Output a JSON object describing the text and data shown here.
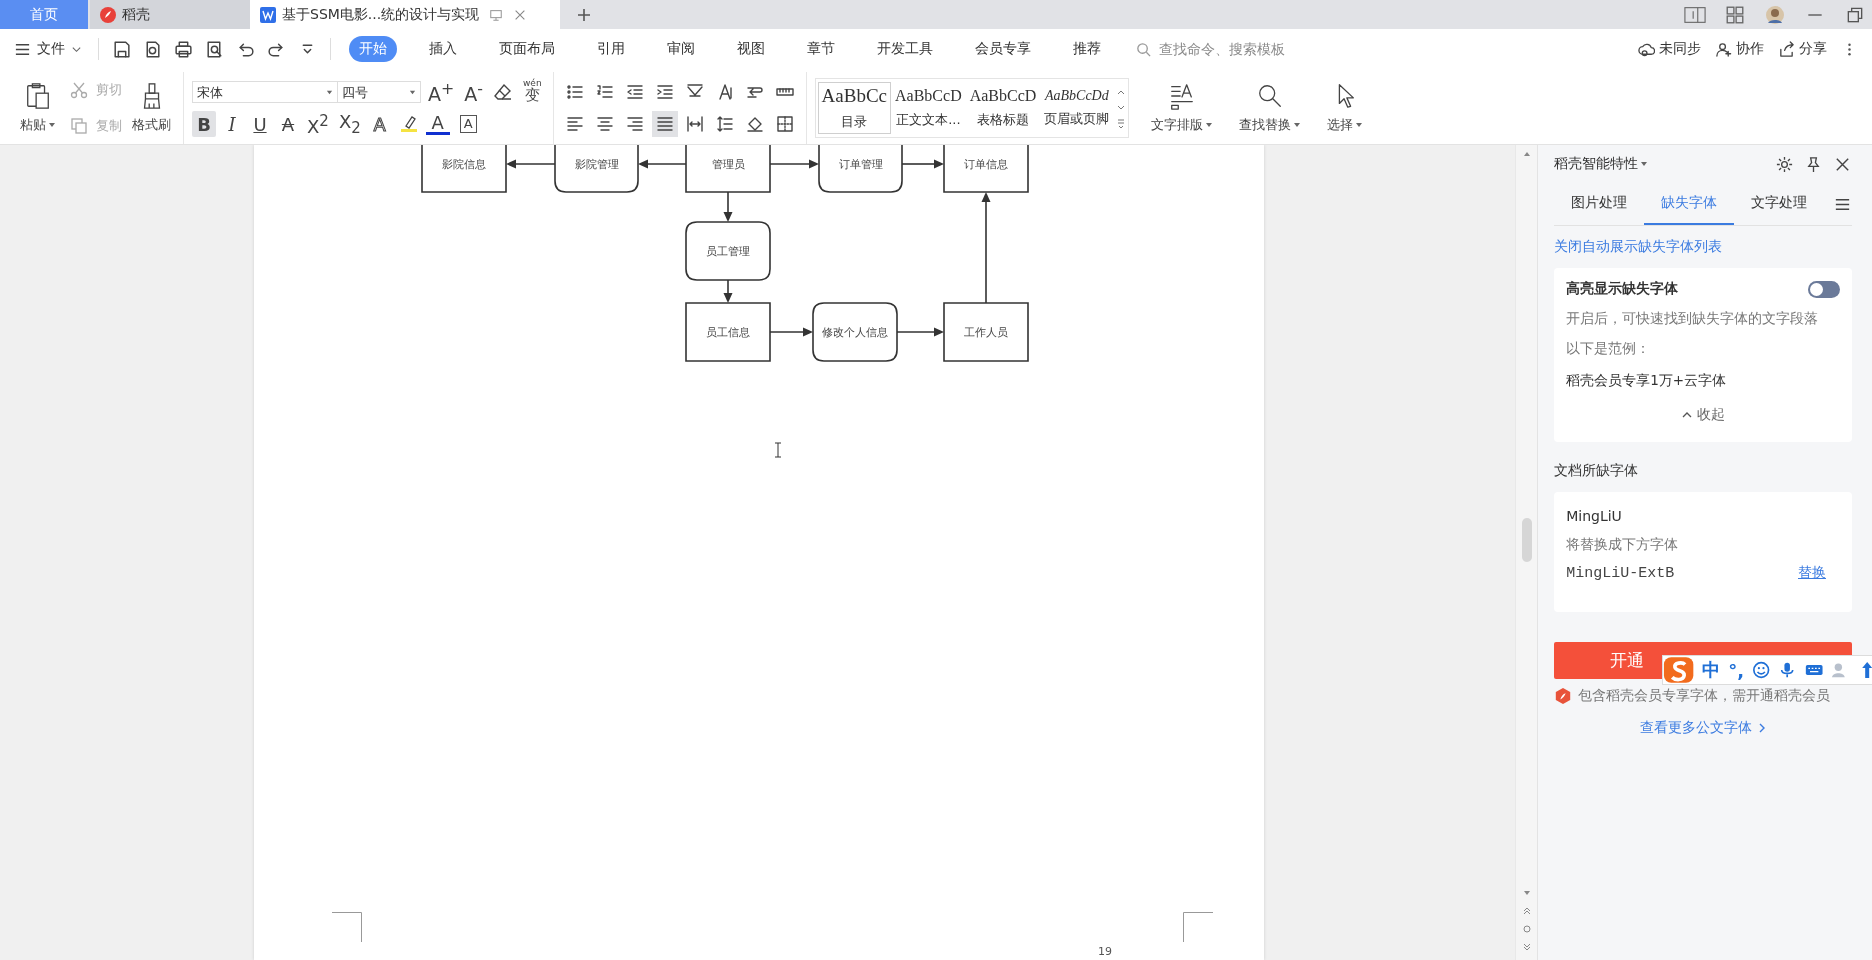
{
  "tabs": [
    {
      "label": "首页",
      "kind": "home",
      "selected": false
    },
    {
      "label": "稻壳",
      "kind": "app",
      "selected": false
    },
    {
      "label": "基于SSM电影...统的设计与实现",
      "kind": "document",
      "selected": true
    }
  ],
  "menu": {
    "file": "文件",
    "items": [
      {
        "label": "开始",
        "selected": true
      },
      {
        "label": "插入",
        "selected": false
      },
      {
        "label": "页面布局",
        "selected": false
      },
      {
        "label": "引用",
        "selected": false
      },
      {
        "label": "审阅",
        "selected": false
      },
      {
        "label": "视图",
        "selected": false
      },
      {
        "label": "章节",
        "selected": false
      },
      {
        "label": "开发工具",
        "selected": false
      },
      {
        "label": "会员专享",
        "selected": false
      },
      {
        "label": "推荐",
        "selected": false
      }
    ],
    "search": {
      "placeholder": "查找命令、搜索模板"
    },
    "actions": [
      "未同步",
      "协作",
      "分享"
    ]
  },
  "ribbon": {
    "clipboard": [
      {
        "label": "粘贴",
        "disabled": false
      },
      {
        "label": "剪切",
        "disabled": true
      },
      {
        "label": "复制",
        "disabled": true
      },
      {
        "label": "格式刷",
        "disabled": false
      }
    ],
    "font": {
      "name": "宋体",
      "size": "四号",
      "top": [
        "A$^{+}$",
        "A$^{-}$"
      ],
      "ruby": "wén",
      "ruby_base": "变",
      "format": [
        {
          "glyph": "B",
          "selected": true
        },
        {
          "glyph": "I",
          "selected": false
        },
        {
          "glyph": "U",
          "selected": false
        },
        {
          "glyph": "A",
          "selected": false
        },
        {
          "glyph": "X$^{2}$",
          "selected": false
        },
        {
          "glyph": "X$_{2}$",
          "selected": false
        },
        {
          "glyph": "A",
          "selected": false
        }
      ],
      "color_glyph": "A",
      "border_glyph": "A"
    },
    "paragraph": {
      "align": [
        {
          "selected": false
        },
        {
          "selected": false
        },
        {
          "selected": false
        },
        {
          "selected": true
        },
        {
          "selected": false
        }
      ]
    },
    "styles": [
      {
        "preview": "AaBbCc",
        "label": "目录",
        "selected": true
      },
      {
        "preview": "AaBbCcD",
        "label": "正文文本...",
        "selected": false
      },
      {
        "preview": "AaBbCcD",
        "label": "表格标题",
        "selected": false
      },
      {
        "preview": "AaBbCcDd",
        "label": "页眉或页脚",
        "selected": false
      }
    ],
    "tools": [
      "文字排版",
      "查找替换",
      "选择"
    ]
  },
  "document": {
    "nodes": [
      {
        "label": "影院信息",
        "kind": "box"
      },
      {
        "label": "影院管理",
        "kind": "rounded"
      },
      {
        "label": "管理员",
        "kind": "box"
      },
      {
        "label": "订单管理",
        "kind": "rounded"
      },
      {
        "label": "订单信息",
        "kind": "box"
      },
      {
        "label": "员工管理",
        "kind": "rounded"
      },
      {
        "label": "员工信息",
        "kind": "box"
      },
      {
        "label": "修改个人信息",
        "kind": "rounded"
      },
      {
        "label": "工作人员",
        "kind": "box"
      }
    ],
    "page_number": "19"
  },
  "panel": {
    "title": "稻壳智能特性",
    "tabs": [
      {
        "label": "图片处理",
        "selected": false
      },
      {
        "label": "缺失字体",
        "selected": true
      },
      {
        "label": "文字处理",
        "selected": false
      }
    ],
    "link": "关闭自动展示缺失字体列表",
    "highlight": {
      "title": "高亮显示缺失字体",
      "on": false,
      "description": "开启后，可快速找到缺失字体的文字段落",
      "example_label": "以下是范例：",
      "example": "稻壳会员专享1万+云字体",
      "collapse": "收起"
    },
    "missing_title": "文档所缺字体",
    "missing_fonts": [
      {
        "name": "MingLiU",
        "hint": "将替换成下方字体",
        "replacement": "MingLiU-ExtB",
        "action": "替换"
      }
    ],
    "cta": "开通",
    "note": "包含稻壳会员专享字体，需开通稻壳会员",
    "more": "查看更多公文字体"
  },
  "ime": {
    "mode": "中",
    "punct": "°,"
  }
}
